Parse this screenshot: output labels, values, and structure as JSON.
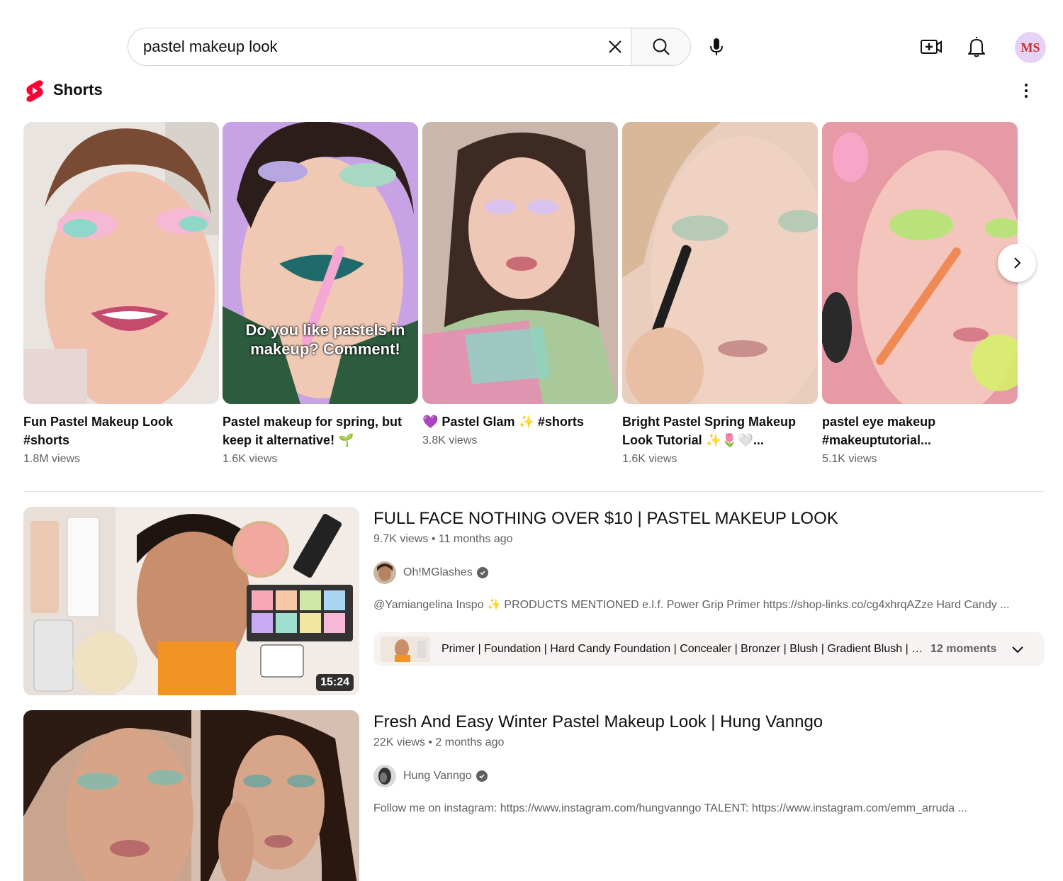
{
  "header": {
    "search_value": "pastel makeup look",
    "avatar_initials": "MS"
  },
  "shorts": {
    "section_title": "Shorts",
    "items": [
      {
        "title": "Fun Pastel Makeup Look #shorts",
        "views": "1.8M views",
        "caption": ""
      },
      {
        "title": "Pastel makeup for spring, but keep it alternative! 🌱",
        "views": "1.6K views",
        "caption": "Do you like pastels in makeup? Comment!"
      },
      {
        "title": "💜 Pastel Glam ✨ #shorts",
        "views": "3.8K views",
        "caption": ""
      },
      {
        "title": "Bright Pastel Spring Makeup Look Tutorial ✨🌷🤍...",
        "views": "1.6K views",
        "caption": ""
      },
      {
        "title": "pastel eye makeup #makeuptutorial...",
        "views": "5.1K views",
        "caption": ""
      }
    ]
  },
  "videos": [
    {
      "title": "FULL FACE NOTHING OVER $10 | PASTEL MAKEUP LOOK",
      "meta": "9.7K views • 11 months ago",
      "channel": "Oh!MGlashes",
      "description": "@Yamiangelina Inspo ✨ PRODUCTS MENTIONED e.l.f. Power Grip Primer https://shop-links.co/cg4xhrqAZze Hard Candy ...",
      "duration": "15:24",
      "chapters": "Primer | Foundation | Hard Candy Foundation | Concealer | Bronzer | Blush | Gradient Blush | Graph...",
      "moments": "12 moments"
    },
    {
      "title": "Fresh And Easy Winter Pastel Makeup Look | Hung Vanngo",
      "meta": "22K views • 2 months ago",
      "channel": "Hung Vanngo",
      "description": "Follow me on instagram: https://www.instagram.com/hungvanngo TALENT: https://www.instagram.com/emm_arruda ..."
    }
  ],
  "icons": {
    "clear": "close-icon",
    "search": "search-icon",
    "mic": "microphone-icon",
    "create": "video-add-icon",
    "notifications": "bell-icon",
    "shorts": "shorts-logo-icon",
    "more": "more-vert-icon",
    "next": "chevron-right-icon",
    "verified": "verified-check-icon",
    "expand": "chevron-down-icon"
  },
  "colors": {
    "shorts_red": "#ff0033",
    "avatar_bg": "#e5d2f5",
    "avatar_text": "#c62f2f",
    "secondary_text": "#606060"
  }
}
